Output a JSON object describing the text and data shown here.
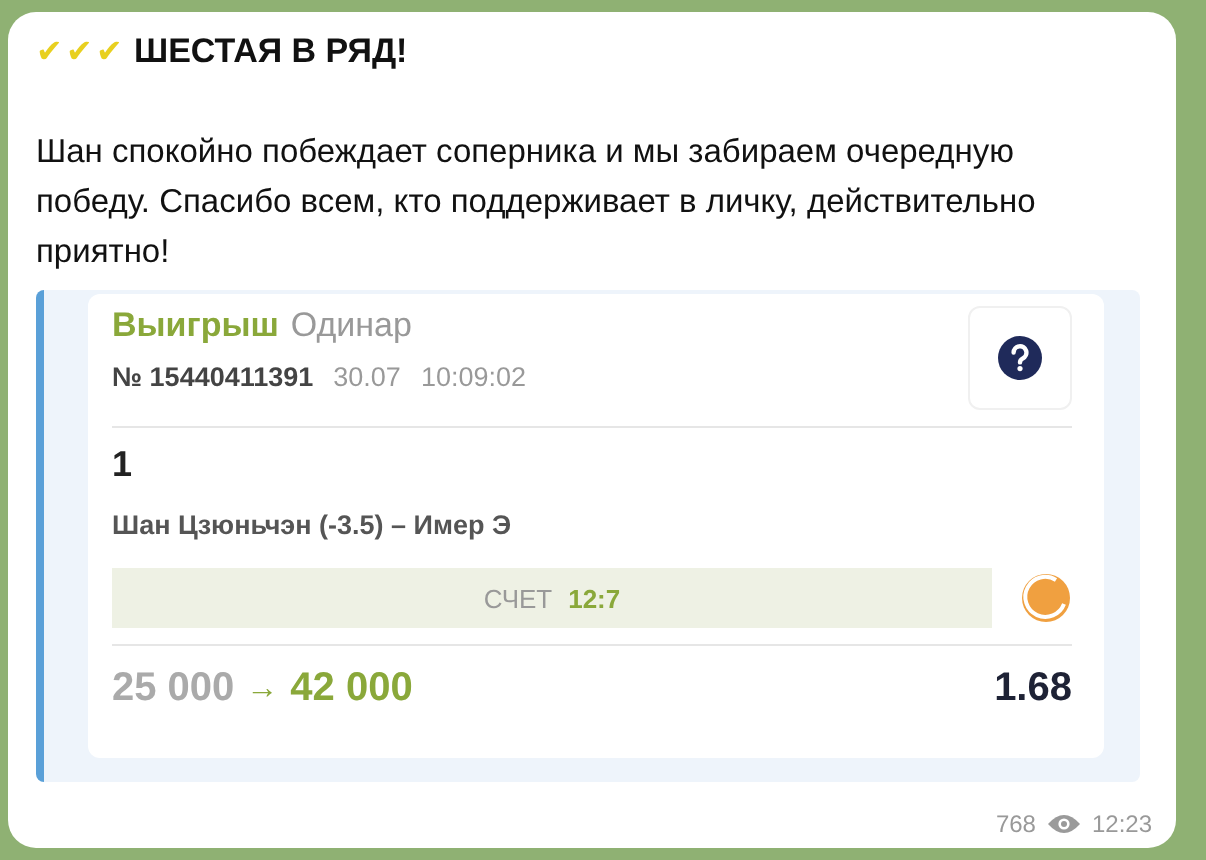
{
  "message": {
    "marks": [
      "✔",
      "✔",
      "✔"
    ],
    "title": "ШЕСТАЯ В РЯД!",
    "text": "Шан спокойно побеждает соперника и мы забираем очередную победу. Спасибо всем, кто поддерживает в личку, действительно приятно!",
    "bet": {
      "status": "Выигрыш",
      "type": "Одинар",
      "number": "№ 15440411391",
      "date": "30.07",
      "time": "10:09:02",
      "pick": "1",
      "match": "Шан Цзюньчэн (-3.5) – Имер Э",
      "score_label": "СЧЕТ",
      "score": "12:7",
      "stake": "25 000",
      "arrow": "→",
      "payout": "42 000",
      "odds": "1.68"
    },
    "views": "768",
    "sent": "12:23"
  }
}
